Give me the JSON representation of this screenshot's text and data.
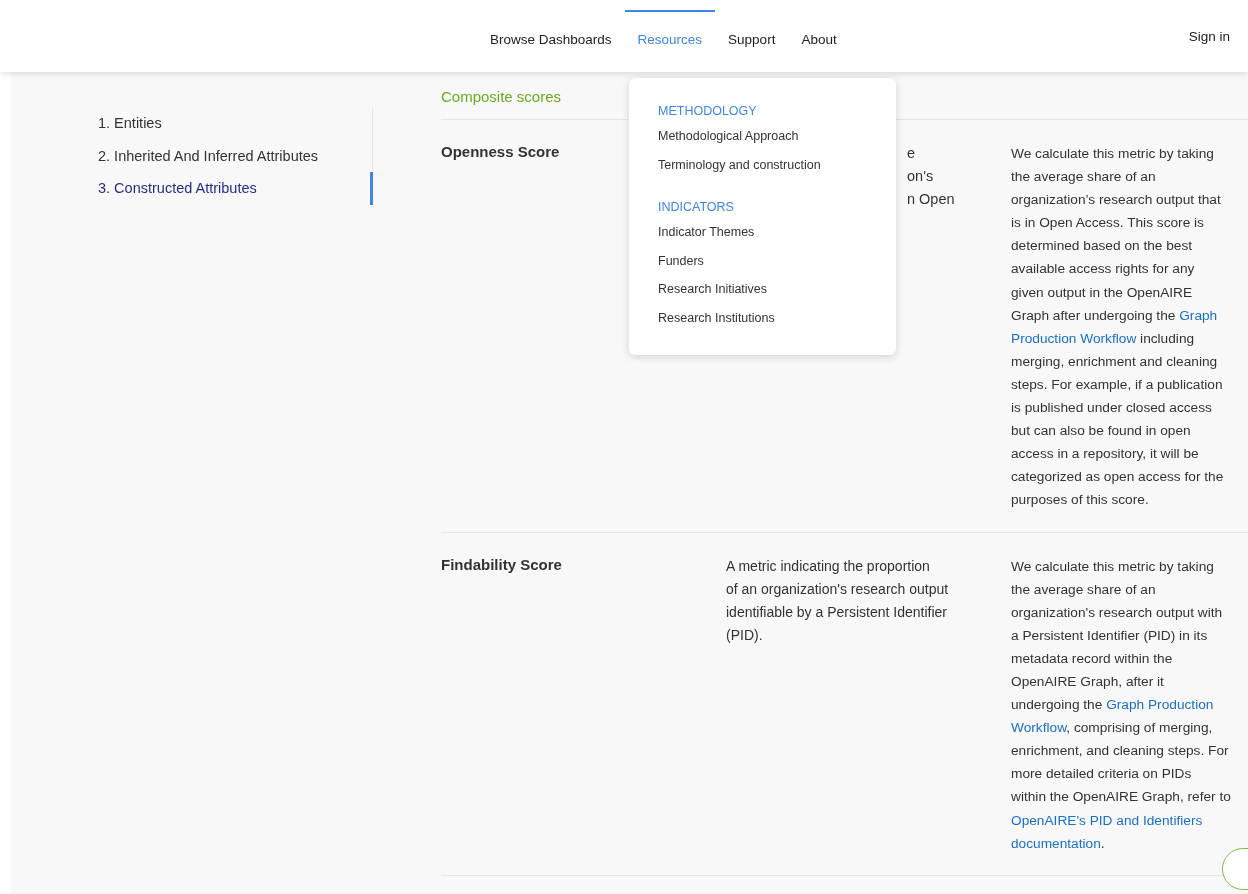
{
  "nav": {
    "items": [
      {
        "label": "Browse Dashboards",
        "selected": false
      },
      {
        "label": "Resources",
        "selected": true
      },
      {
        "label": "Support",
        "selected": false
      },
      {
        "label": "About",
        "selected": false
      }
    ],
    "sign_in": "Sign in"
  },
  "sidebar": {
    "items": [
      {
        "label": "1. Entities",
        "selected": false
      },
      {
        "label": "2. Inherited And Inferred Attributes",
        "selected": false
      },
      {
        "label": "3. Constructed Attributes",
        "selected": true
      }
    ]
  },
  "section_title": "Composite scores",
  "rows": [
    {
      "name": "Openness Score",
      "definition_fragments": [
        "e",
        "on's",
        "n Open"
      ],
      "calculation": [
        "We calculate this metric by taking",
        "the average share of an",
        "organization’s research output that",
        "is in Open Access. This score is",
        "determined based on the best",
        "available access rights for any",
        "given output in the OpenAIRE",
        [
          {
            "text": "Graph after undergoing the "
          },
          {
            "kind": "link",
            "text": "Graph"
          }
        ],
        [
          {
            "kind": "link",
            "text": "Production Workflow"
          },
          {
            "text": " including"
          }
        ],
        "merging, enrichment and cleaning",
        "steps. For example, if a publication",
        "is published under closed access",
        "but can also be found in open",
        "access in a repository, it will be",
        "categorized as open access for the",
        "purposes of this score."
      ]
    },
    {
      "name": "Findability Score",
      "definition": [
        "A metric indicating the proportion",
        "of an organization's research output",
        "identifiable by a Persistent Identifier",
        "(PID)."
      ],
      "calculation": [
        "We calculate this metric by taking",
        "the average share of an",
        "organization's research output with",
        "a Persistent Identifier (PID) in its",
        "metadata record within the",
        "OpenAIRE Graph, after it",
        [
          {
            "text": "undergoing the "
          },
          {
            "kind": "link",
            "text": "Graph Production"
          }
        ],
        [
          {
            "kind": "link",
            "text": "Workflow"
          },
          {
            "text": ", comprising of merging,"
          }
        ],
        "enrichment, and cleaning steps. For",
        "more detailed criteria on PIDs",
        "within the OpenAIRE Graph, refer to",
        [
          {
            "kind": "link",
            "text": "OpenAIRE's PID and Identifiers"
          }
        ],
        [
          {
            "kind": "link",
            "text": "documentation"
          },
          {
            "text": "."
          }
        ]
      ]
    }
  ],
  "dropdown": {
    "groups": [
      {
        "heading": "METHODOLOGY",
        "items": [
          "Methodological Approach",
          "Terminology and construction"
        ]
      },
      {
        "heading": "INDICATORS",
        "items": [
          "Indicator Themes",
          "Funders",
          "Research Initiatives",
          "Research Institutions"
        ]
      }
    ]
  }
}
